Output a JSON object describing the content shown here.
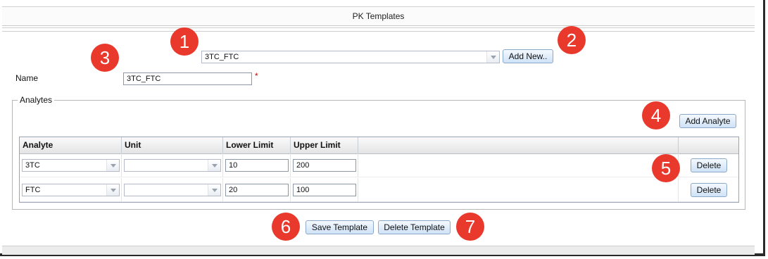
{
  "title": "PK Templates",
  "template_select": {
    "value": "3TC_FTC"
  },
  "add_new_button": "Add New..",
  "name_field": {
    "label": "Name",
    "value": "3TC_FTC",
    "required_mark": "*"
  },
  "analytes": {
    "legend": "Analytes",
    "add_button": "Add Analyte",
    "columns": [
      "Analyte",
      "Unit",
      "Lower Limit",
      "Upper Limit",
      "",
      ""
    ],
    "rows": [
      {
        "analyte": "3TC",
        "unit": "",
        "lower": "10",
        "upper": "200",
        "delete": "Delete"
      },
      {
        "analyte": "FTC",
        "unit": "",
        "lower": "20",
        "upper": "100",
        "delete": "Delete"
      }
    ]
  },
  "footer": {
    "save_button": "Save Template",
    "delete_button": "Delete Template"
  },
  "badges": [
    "1",
    "2",
    "3",
    "4",
    "5",
    "6",
    "7"
  ]
}
